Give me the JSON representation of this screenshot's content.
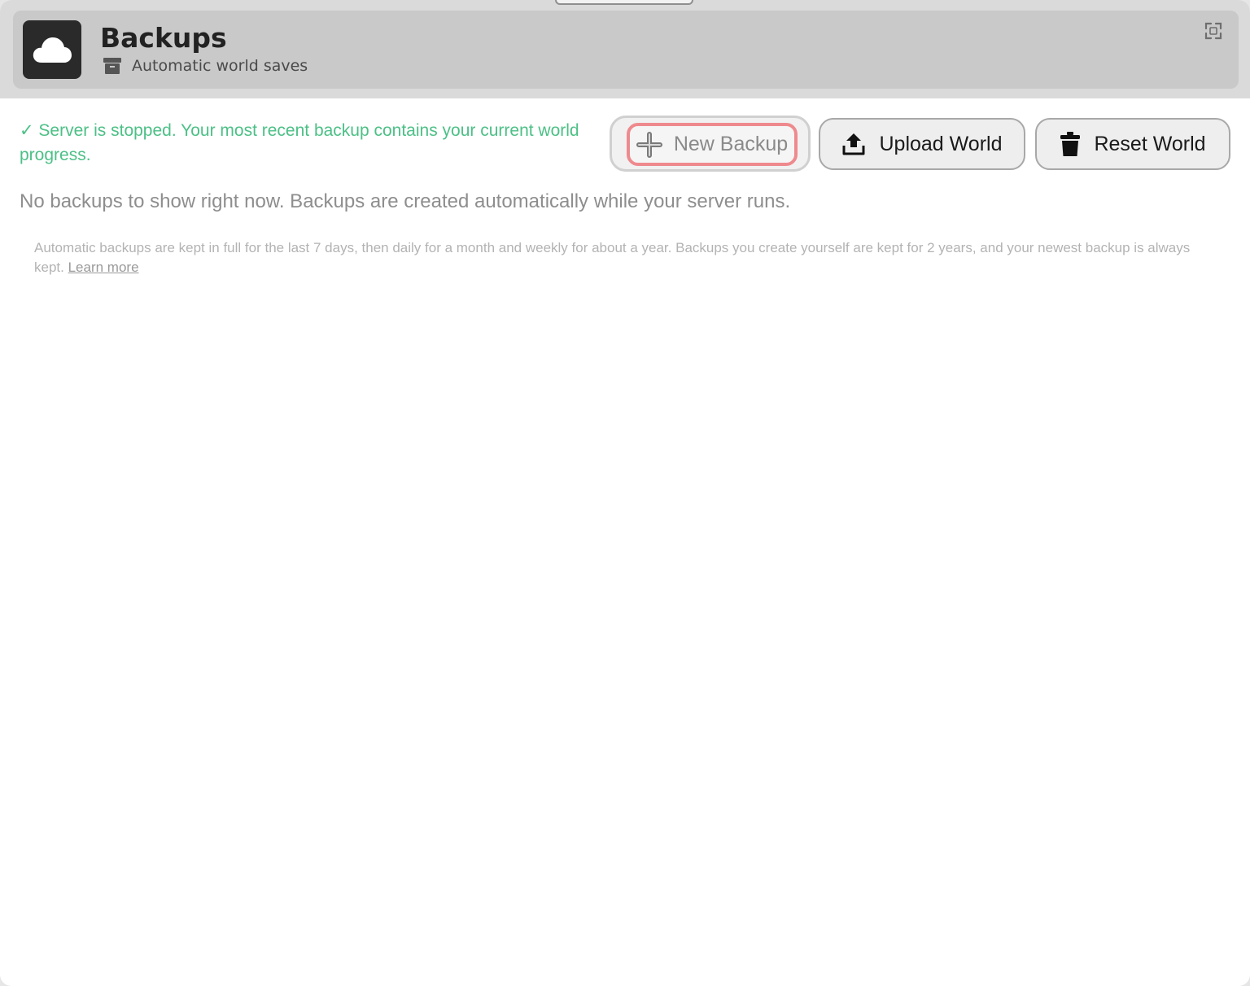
{
  "header": {
    "title": "Backups",
    "subtitle": "Automatic world saves",
    "icons": {
      "app": "cloud-icon",
      "subtitle": "archive-box-icon",
      "expand": "expand-icon"
    }
  },
  "status": {
    "message": "✓ Server is stopped. Your most recent backup contains your current world progress.",
    "color": "#4cc086"
  },
  "actions": {
    "new_backup": {
      "label": "New Backup",
      "icon": "plus-icon",
      "state": "disabled-focused"
    },
    "upload_world": {
      "label": "Upload World",
      "icon": "upload-icon"
    },
    "reset_world": {
      "label": "Reset World",
      "icon": "trash-icon"
    }
  },
  "empty_state": {
    "message": "No backups to show right now. Backups are created automatically while your server runs."
  },
  "retention": {
    "text": "Automatic backups are kept in full for the last 7 days, then daily for a month and weekly for about a year. Backups you create yourself are kept for 2 years, and your newest backup is always kept. ",
    "link_label": "Learn more"
  },
  "colors": {
    "focus_ring": "#ee8a8e",
    "header_bg": "#c9c9c9",
    "app_icon_bg": "#2a2a2a"
  }
}
